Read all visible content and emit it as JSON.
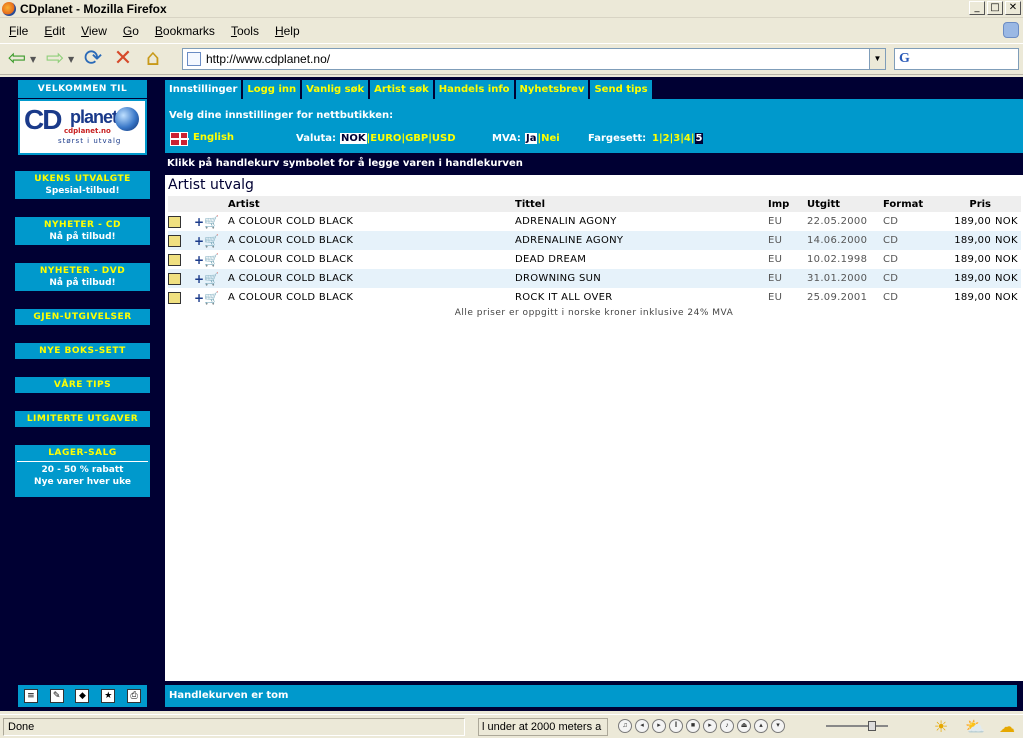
{
  "window": {
    "title": "CDplanet - Mozilla Firefox",
    "buttons": {
      "minimize": "_",
      "maximize": "□",
      "close": "✕"
    }
  },
  "menu": [
    "File",
    "Edit",
    "View",
    "Go",
    "Bookmarks",
    "Tools",
    "Help"
  ],
  "address": {
    "url": "http://www.cdplanet.no/"
  },
  "search": {
    "engine_glyph": "G"
  },
  "sidebar": {
    "welcome": "VELKOMMEN TIL",
    "logo": {
      "cd": "CD",
      "planet": "planet",
      "domain": "cdplanet.no",
      "tagline": "størst i utvalg"
    },
    "items": [
      {
        "label": "UKENS UTVALGTE",
        "sub": "Spesial-tilbud!"
      },
      {
        "label": "NYHETER - CD",
        "sub": "Nå på tilbud!"
      },
      {
        "label": "NYHETER - DVD",
        "sub": "Nå på tilbud!"
      },
      {
        "label": "GJEN-UTGIVELSER"
      },
      {
        "label": "NYE BOKS-SETT"
      },
      {
        "label": "VÅRE TIPS"
      },
      {
        "label": "LIMITERTE UTGAVER"
      },
      {
        "label": "LAGER-SALG",
        "sub": "20 - 50 % rabatt",
        "sub2": "Nye varer hver uke"
      }
    ]
  },
  "tabs": [
    "Innstillinger",
    "Logg inn",
    "Vanlig søk",
    "Artist søk",
    "Handels info",
    "Nyhetsbrev",
    "Send tips"
  ],
  "settings": {
    "heading": "Velg dine innstillinger for nettbutikken:",
    "language": "English",
    "valuta_label": "Valuta:",
    "currencies": [
      "NOK",
      "EURO",
      "GBP",
      "USD"
    ],
    "currency_selected": "NOK",
    "mva_label": "MVA:",
    "mva_options": [
      "Ja",
      "Nei"
    ],
    "mva_selected": "Ja",
    "fargesett_label": "Fargesett:",
    "fargesett_options": [
      "1",
      "2",
      "3",
      "4",
      "5"
    ],
    "fargesett_selected": "5"
  },
  "hint": "Klikk på handlekurv symbolet for å legge varen i handlekurven",
  "results": {
    "heading": "Artist utvalg",
    "columns": [
      "Artist",
      "Tittel",
      "Imp",
      "Utgitt",
      "Format",
      "Pris"
    ],
    "rows": [
      {
        "artist": "A COLOUR COLD BLACK",
        "title": "ADRENALIN AGONY",
        "imp": "EU",
        "date": "22.05.2000",
        "format": "CD",
        "price": "189,00",
        "currency": "NOK"
      },
      {
        "artist": "A COLOUR COLD BLACK",
        "title": "ADRENALINE AGONY",
        "imp": "EU",
        "date": "14.06.2000",
        "format": "CD",
        "price": "189,00",
        "currency": "NOK"
      },
      {
        "artist": "A COLOUR COLD BLACK",
        "title": "DEAD DREAM",
        "imp": "EU",
        "date": "10.02.1998",
        "format": "CD",
        "price": "189,00",
        "currency": "NOK"
      },
      {
        "artist": "A COLOUR COLD BLACK",
        "title": "DROWNING SUN",
        "imp": "EU",
        "date": "31.01.2000",
        "format": "CD",
        "price": "189,00",
        "currency": "NOK"
      },
      {
        "artist": "A COLOUR COLD BLACK",
        "title": "ROCK IT ALL OVER",
        "imp": "EU",
        "date": "25.09.2001",
        "format": "CD",
        "price": "189,00",
        "currency": "NOK"
      }
    ],
    "note": "Alle priser er oppgitt i norske kroner inklusive 24% MVA"
  },
  "cart": "Handlekurven er tom",
  "status": {
    "text": "Done",
    "media": "l under at 2000 meters a"
  },
  "colors": {
    "accent": "#0099cc",
    "background": "#000033",
    "link": "#ffff00"
  }
}
